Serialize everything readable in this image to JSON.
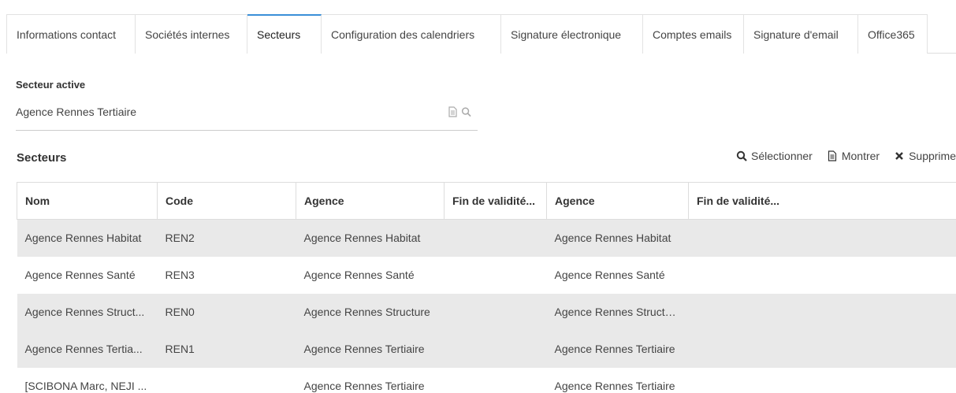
{
  "tabs": [
    {
      "label": "Informations contact",
      "active": false
    },
    {
      "label": "Sociétés internes",
      "active": false
    },
    {
      "label": "Secteurs",
      "active": true
    },
    {
      "label": "Configuration des calendriers",
      "active": false
    },
    {
      "label": "Signature électronique",
      "active": false
    },
    {
      "label": "Comptes emails",
      "active": false
    },
    {
      "label": "Signature d'email",
      "active": false
    },
    {
      "label": "Office365",
      "active": false
    }
  ],
  "active_sector": {
    "label": "Secteur active",
    "value": "Agence Rennes Tertiaire"
  },
  "sectors": {
    "title": "Secteurs",
    "actions": {
      "select": "Sélectionner",
      "show": "Montrer",
      "delete": "Supprime"
    },
    "columns": [
      "Nom",
      "Code",
      "Agence",
      "Fin de validité...",
      "Agence",
      "Fin de validité..."
    ],
    "rows": [
      [
        "Agence Rennes Habitat",
        "REN2",
        "Agence Rennes Habitat",
        "",
        "Agence Rennes Habitat",
        ""
      ],
      [
        "Agence Rennes Santé",
        "REN3",
        "Agence Rennes Santé",
        "",
        "Agence Rennes Santé",
        ""
      ],
      [
        "Agence Rennes Struct...",
        "REN0",
        "Agence Rennes Structure",
        "",
        "Agence Rennes Structure",
        ""
      ],
      [
        "Agence Rennes Tertia...",
        "REN1",
        "Agence Rennes Tertiaire",
        "",
        "Agence Rennes Tertiaire",
        ""
      ],
      [
        "[SCIBONA Marc, NEJI ...",
        "",
        "Agence Rennes Tertiaire",
        "",
        "Agence Rennes Tertiaire",
        ""
      ]
    ]
  },
  "colors": {
    "accent": "#3a8fd8",
    "row_grey": "#e9e9e9"
  }
}
